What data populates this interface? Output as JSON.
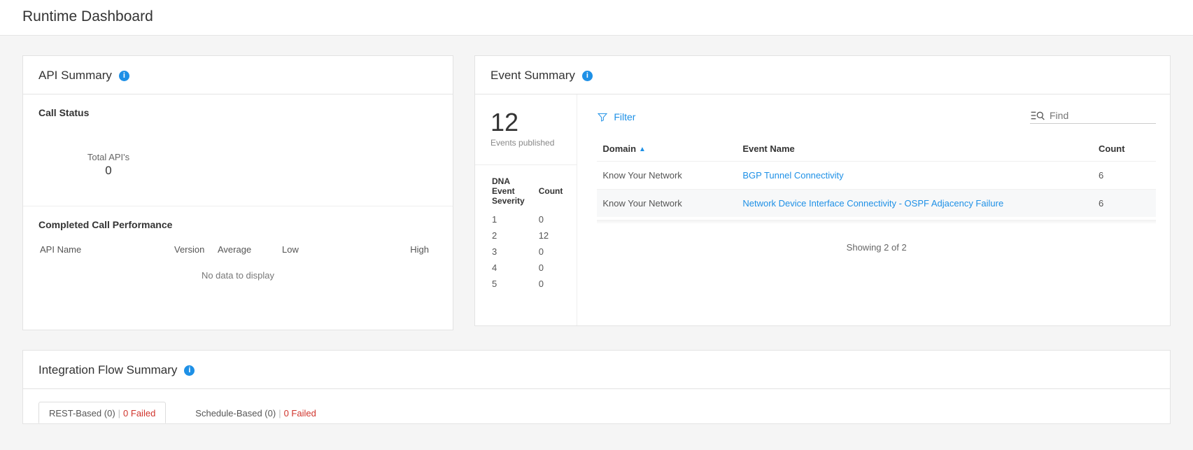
{
  "page_title": "Runtime Dashboard",
  "api_summary": {
    "title": "API Summary",
    "call_status_title": "Call Status",
    "total_apis_label": "Total API's",
    "total_apis_value": "0",
    "ccp_title": "Completed Call Performance",
    "columns": {
      "api_name": "API Name",
      "version": "Version",
      "average": "Average",
      "low": "Low",
      "high": "High"
    },
    "no_data": "No data to display"
  },
  "event_summary": {
    "title": "Event Summary",
    "events_count": "12",
    "events_published_label": "Events published",
    "severity_header": {
      "sev": "DNA Event Severity",
      "count": "Count"
    },
    "severity_rows": [
      {
        "sev": "1",
        "count": "0"
      },
      {
        "sev": "2",
        "count": "12"
      },
      {
        "sev": "3",
        "count": "0"
      },
      {
        "sev": "4",
        "count": "0"
      },
      {
        "sev": "5",
        "count": "0"
      }
    ],
    "filter_label": "Filter",
    "find_placeholder": "Find",
    "columns": {
      "domain": "Domain",
      "event_name": "Event Name",
      "count": "Count"
    },
    "rows": [
      {
        "domain": "Know Your Network",
        "event_name": "BGP Tunnel Connectivity",
        "count": "6"
      },
      {
        "domain": "Know Your Network",
        "event_name": "Network Device Interface Connectivity - OSPF Adjacency Failure",
        "count": "6"
      }
    ],
    "showing_text": "Showing 2 of 2"
  },
  "integration": {
    "title": "Integration Flow Summary",
    "tabs": {
      "rest": {
        "label": "REST-Based (0)",
        "failed": "0 Failed"
      },
      "schedule": {
        "label": "Schedule-Based (0)",
        "failed": "0 Failed"
      }
    }
  }
}
